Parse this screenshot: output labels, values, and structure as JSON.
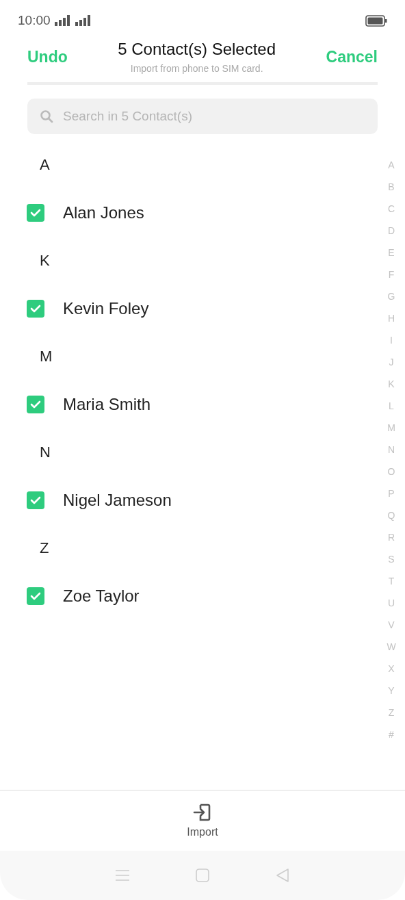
{
  "status_bar": {
    "time": "10:00"
  },
  "header": {
    "left_action": "Undo",
    "title": "5 Contact(s) Selected",
    "subtitle": "Import from phone to SIM card.",
    "right_action": "Cancel"
  },
  "search": {
    "placeholder": "Search in 5 Contact(s)"
  },
  "sections": [
    {
      "letter": "A",
      "contacts": [
        {
          "name": "Alan Jones",
          "checked": true
        }
      ]
    },
    {
      "letter": "K",
      "contacts": [
        {
          "name": "Kevin Foley",
          "checked": true
        }
      ]
    },
    {
      "letter": "M",
      "contacts": [
        {
          "name": "Maria Smith",
          "checked": true
        }
      ]
    },
    {
      "letter": "N",
      "contacts": [
        {
          "name": "Nigel Jameson",
          "checked": true
        }
      ]
    },
    {
      "letter": "Z",
      "contacts": [
        {
          "name": "Zoe Taylor",
          "checked": true
        }
      ]
    }
  ],
  "index_letters": [
    "A",
    "B",
    "C",
    "D",
    "E",
    "F",
    "G",
    "H",
    "I",
    "J",
    "K",
    "L",
    "M",
    "N",
    "O",
    "P",
    "Q",
    "R",
    "S",
    "T",
    "U",
    "V",
    "W",
    "X",
    "Y",
    "Z",
    "#"
  ],
  "bottom_action": {
    "label": "Import"
  }
}
